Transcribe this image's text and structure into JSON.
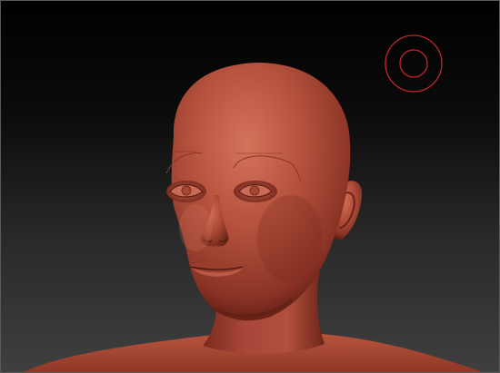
{
  "viewport": {
    "model": "sculpted-head-bust",
    "brush_cursor_icon": "brush-cursor-icon"
  },
  "colors": {
    "background_top": "#000000",
    "background_bottom": "#3f3f3f",
    "clay": "#b5523e",
    "clay_shadow": "#6e2418",
    "clay_highlight": "#d97a62",
    "brush_cursor": "#c4262c"
  }
}
